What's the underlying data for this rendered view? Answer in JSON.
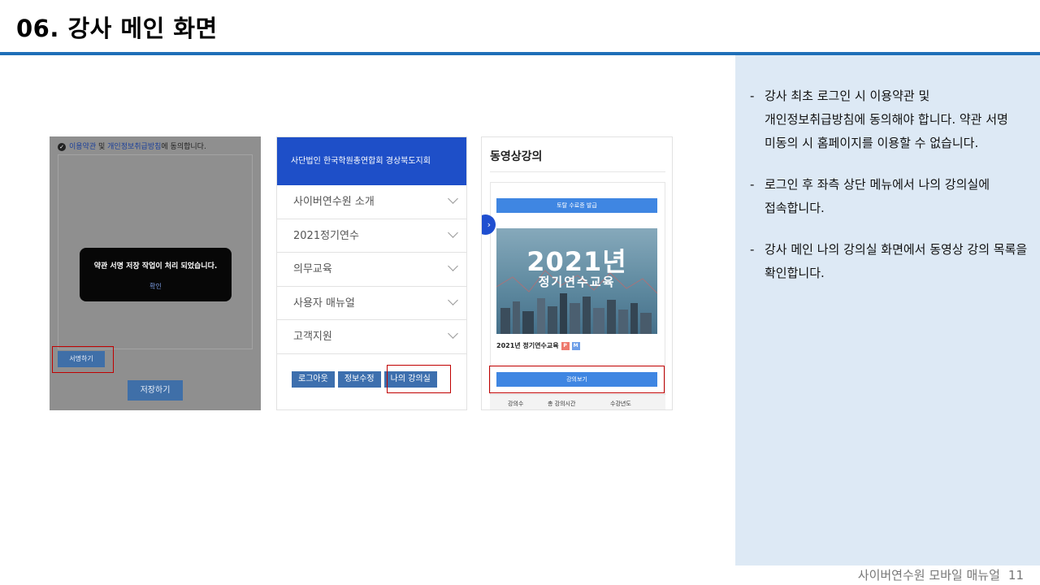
{
  "slide": {
    "title": "06. 강사 메인 화면",
    "footer_text": "사이버연수원 모바일 매뉴얼",
    "page_number": "11",
    "accent_color": "#1f6fb8",
    "panel_color": "#dde9f5"
  },
  "notes": [
    "강사 최초 로그인 시 이용약관 및 개인정보취급방침에 동의해야 합니다. 약관 서명 미동의 시 홈페이지를 이용할 수 없습니다.",
    "로그인 후 좌측 상단 메뉴에서 나의 강의실에 접속합니다.",
    "강사 메인 나의 강의실 화면에서 동영상 강의 목록을 확인합니다."
  ],
  "screen1": {
    "agree_terms": "이용약관",
    "agree_and": "및",
    "agree_privacy": "개인정보취급방침",
    "agree_suffix": "에 동의합니다.",
    "dialog_message": "약관 서명 저장 작업이 처리 되었습니다.",
    "dialog_ok": "확인",
    "sign_button": "서명하기",
    "save_button": "저장하기"
  },
  "screen2": {
    "brand": "사단법인 한국학원총연합회 경상북도지회",
    "menu": [
      "사이버연수원 소개",
      "2021정기연수",
      "의무교육",
      "사용자 매뉴얼",
      "고객지원"
    ],
    "buttons": {
      "logout": "로그아웃",
      "edit_info": "정보수정",
      "my_classroom": "나의 강의실"
    }
  },
  "screen3": {
    "heading": "동영상강의",
    "cert_button": "토탈 수료증 발급",
    "banner_year": "2021년",
    "banner_subtitle": "정기연수교육",
    "course_title": "2021년 정기연수교육",
    "tag_p": "P",
    "tag_m": "M",
    "view_button": "강의보기",
    "table_headers": [
      "강의수",
      "총 강의시간",
      "수강년도"
    ]
  }
}
